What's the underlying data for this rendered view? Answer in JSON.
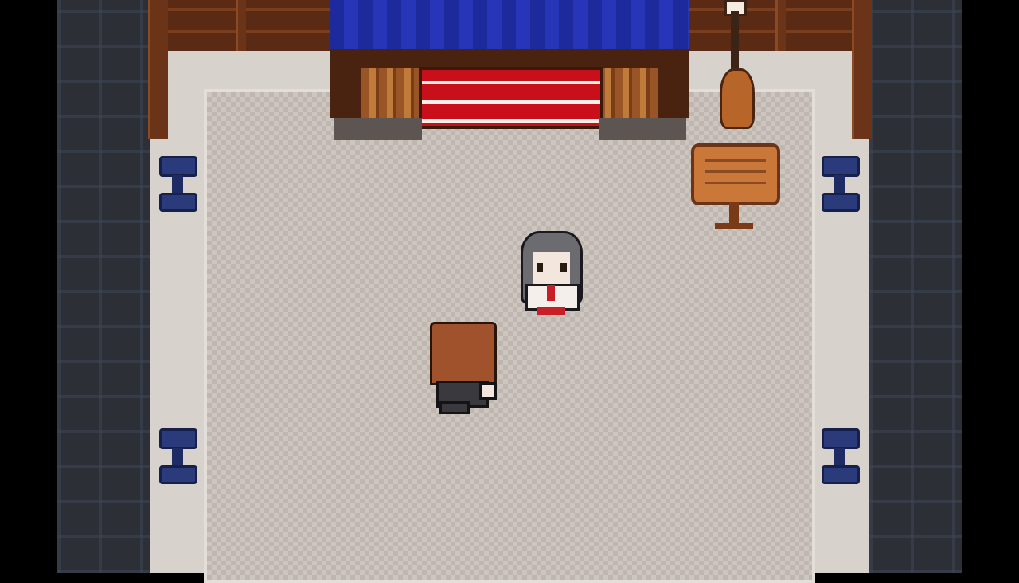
{
  "scene": {
    "game": "",
    "location": "",
    "palette": {
      "wall": "#2d2f37",
      "floor": "#cdc6c0",
      "roof": "#1d2a9c",
      "door": "#c9101a",
      "wood": "#6b3318"
    }
  },
  "characters": [
    {
      "role": "npc",
      "icon": "girl-gray-hair-sprite"
    },
    {
      "role": "player",
      "icon": "boy-brown-hair-sprite"
    }
  ],
  "objects": [
    {
      "icon": "stage-icon"
    },
    {
      "icon": "lamp-post-icon"
    },
    {
      "icon": "wooden-sign-icon"
    },
    {
      "icon": "stool-icon"
    }
  ]
}
